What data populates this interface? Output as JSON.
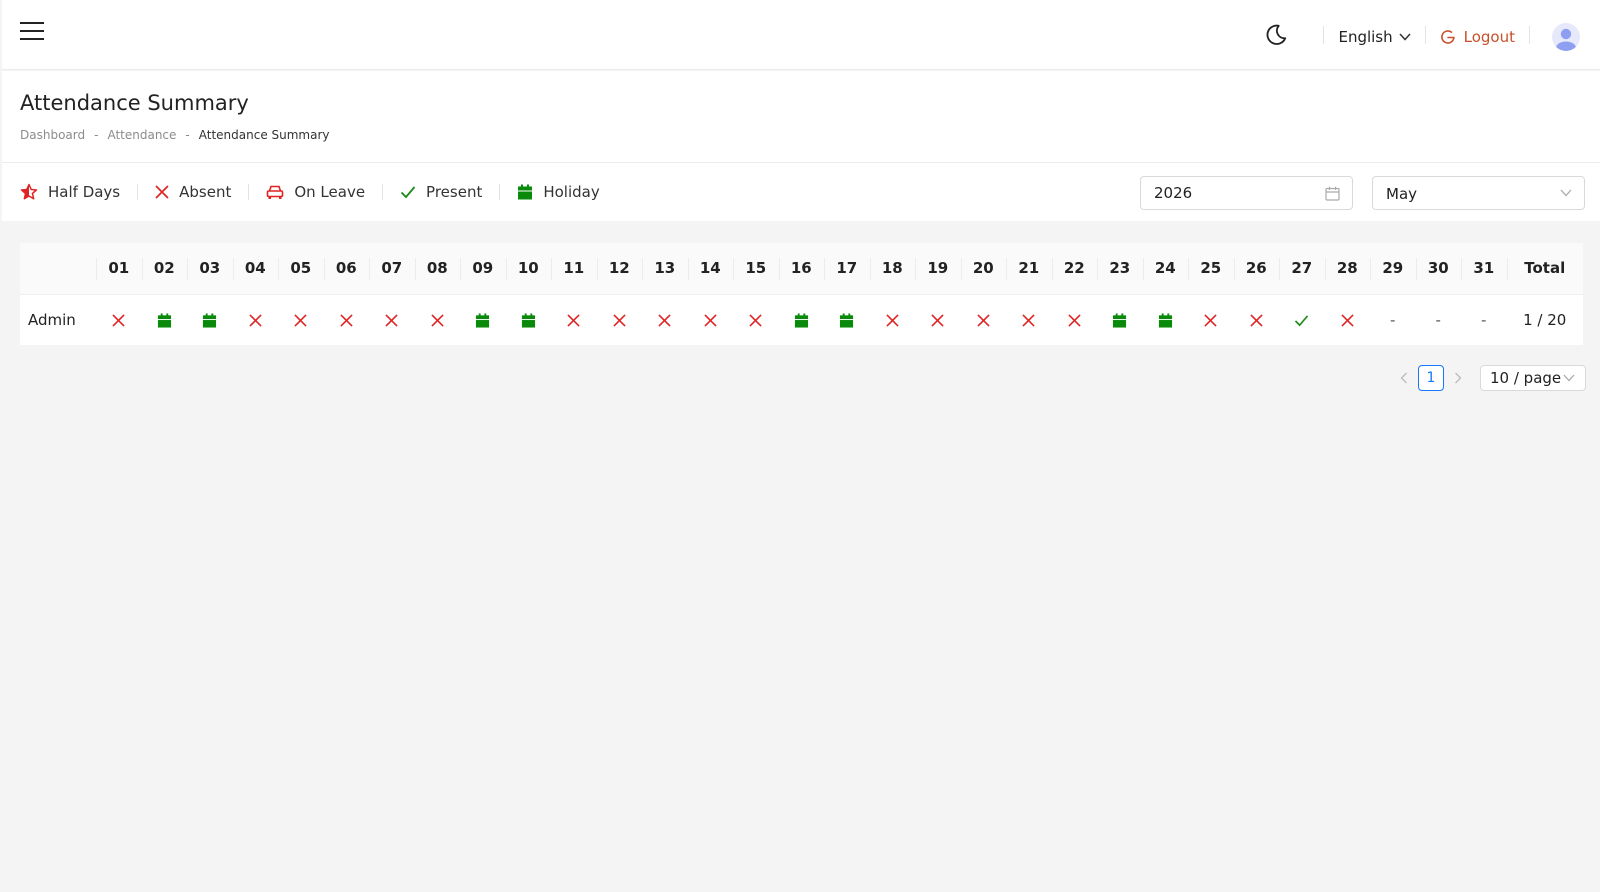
{
  "header": {
    "language": "English",
    "logout_label": "Logout"
  },
  "page": {
    "title": "Attendance Summary",
    "breadcrumb": [
      "Dashboard",
      "Attendance",
      "Attendance Summary"
    ]
  },
  "legend": [
    {
      "label": "Half Days",
      "icon": "half-day-star-icon",
      "color": "#e02424"
    },
    {
      "label": "Absent",
      "icon": "absent-x-icon",
      "color": "#e02424"
    },
    {
      "label": "On Leave",
      "icon": "on-leave-car-icon",
      "color": "#e02424"
    },
    {
      "label": "Present",
      "icon": "present-check-icon",
      "color": "#1a8a1a"
    },
    {
      "label": "Holiday",
      "icon": "holiday-calendar-icon",
      "color": "#0a8a0a"
    }
  ],
  "filters": {
    "year": "2026",
    "month": "May"
  },
  "table": {
    "days": [
      "01",
      "02",
      "03",
      "04",
      "05",
      "06",
      "07",
      "08",
      "09",
      "10",
      "11",
      "12",
      "13",
      "14",
      "15",
      "16",
      "17",
      "18",
      "19",
      "20",
      "21",
      "22",
      "23",
      "24",
      "25",
      "26",
      "27",
      "28",
      "29",
      "30",
      "31"
    ],
    "total_header": "Total",
    "rows": [
      {
        "name": "Admin",
        "statuses": [
          "absent",
          "holiday",
          "holiday",
          "absent",
          "absent",
          "absent",
          "absent",
          "absent",
          "holiday",
          "holiday",
          "absent",
          "absent",
          "absent",
          "absent",
          "absent",
          "holiday",
          "holiday",
          "absent",
          "absent",
          "absent",
          "absent",
          "absent",
          "holiday",
          "holiday",
          "absent",
          "absent",
          "present",
          "absent",
          "none",
          "none",
          "none"
        ],
        "none_text": "-",
        "total": "1 / 20"
      }
    ]
  },
  "pagination": {
    "current_page": "1",
    "page_size": "10 / page"
  }
}
